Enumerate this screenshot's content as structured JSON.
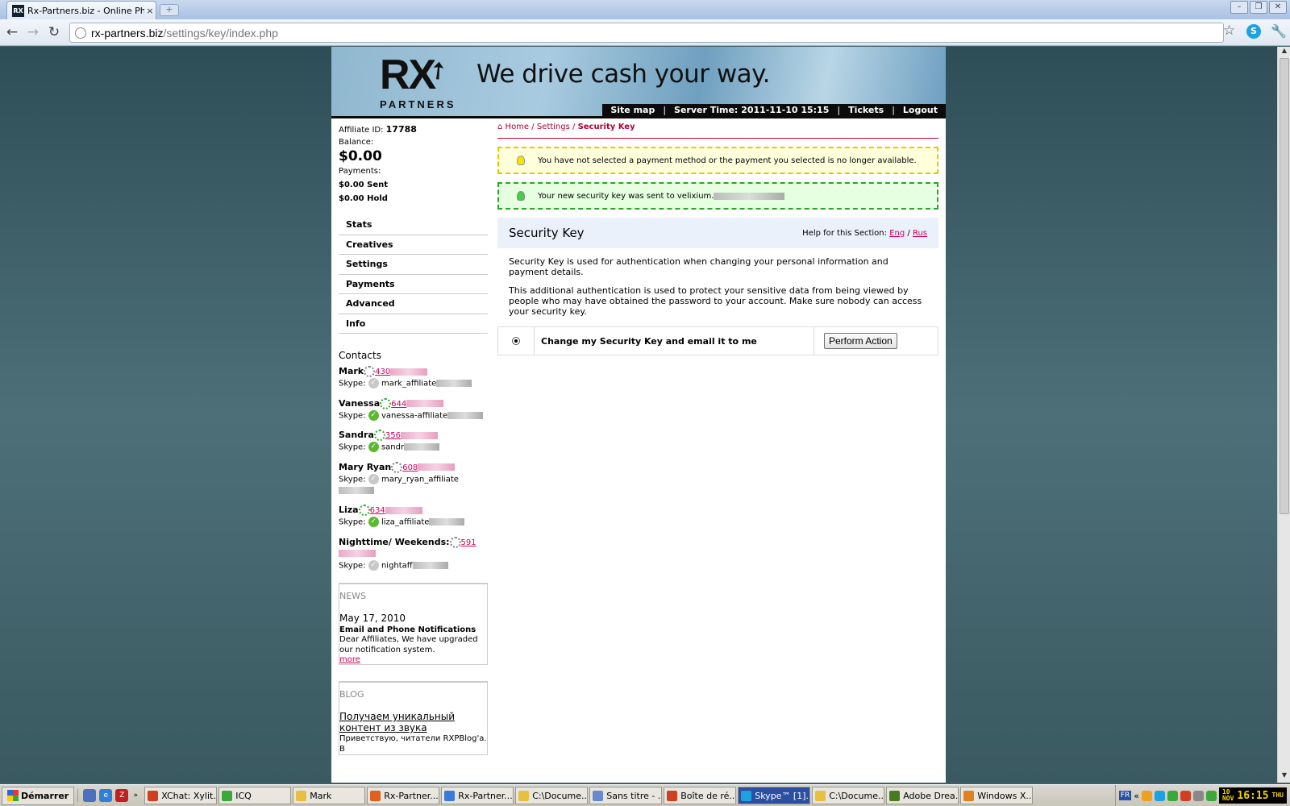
{
  "browser": {
    "tab_title": "Rx-Partners.biz - Online Pharm",
    "tab_close": "×",
    "url_domain": "rx-partners.biz",
    "url_path": "/settings/key/index.php"
  },
  "header": {
    "logo_text": "RX",
    "logo_sub": "PARTNERS",
    "slogan": "We drive cash your way.",
    "nav": {
      "sitemap": "Site map",
      "server_time": "Server Time: 2011-11-10 15:15",
      "tickets": "Tickets",
      "logout": "Logout"
    }
  },
  "sidebar": {
    "affiliate_label": "Affiliate ID:",
    "affiliate_id": "17788",
    "balance_label": "Balance:",
    "balance_value": "$0.00",
    "payments_label": "Payments:",
    "payments_sent": "$0.00 Sent",
    "payments_hold": "$0.00 Hold",
    "menu": [
      "Stats",
      "Creatives",
      "Settings",
      "Payments",
      "Advanced",
      "Info"
    ],
    "contacts_title": "Contacts",
    "skype_label": "Skype:",
    "contacts": [
      {
        "name": "Mark",
        "phone": "430",
        "skype": "mark_affiliate",
        "online": false
      },
      {
        "name": "Vanessa",
        "phone": "644",
        "skype": "vanessa-affiliate",
        "online": true
      },
      {
        "name": "Sandra",
        "phone": "356",
        "skype": "sandr",
        "online": true
      },
      {
        "name": "Mary Ryan",
        "phone": "608",
        "skype": "mary_ryan_affiliate",
        "online": false
      },
      {
        "name": "Liza",
        "phone": "634",
        "skype": "liza_affiliate",
        "online": true
      },
      {
        "name": "Nighttime/ Weekends:",
        "phone": "591",
        "skype": "nightaff",
        "online": false
      }
    ],
    "news": {
      "heading": "NEWS",
      "date": "May 17, 2010",
      "title": "Email and Phone Notifications",
      "text": "Dear Affiliates, We have upgraded our notification system.",
      "more": "more"
    },
    "blog": {
      "heading": "BLOG",
      "title": "Получаем уникальный контент из звука",
      "text": "Приветствую, читатели RXPBlog'а. В"
    }
  },
  "main": {
    "breadcrumb": {
      "home": "Home",
      "sep1": " / ",
      "settings": "Settings",
      "sep2": " / ",
      "current": "Security Key"
    },
    "warning": "You have not selected a payment method or the payment you selected is no longer available.",
    "success": "Your new security key was sent to velixium.",
    "section_title": "Security Key",
    "help_label": "Help for this Section:",
    "help_eng": "Eng",
    "help_sep": " / ",
    "help_rus": "Rus",
    "para1": "Security Key is used for authentication when changing your personal information and payment details.",
    "para2": "This additional authentication is used to protect your sensitive data from being viewed by people who may have obtained the password to your account. Make sure nobody can access your security key.",
    "action_label": "Change my Security Key and email it to me",
    "action_button": "Perform Action"
  },
  "taskbar": {
    "start": "Démarrer",
    "more": "»",
    "tasks": [
      {
        "label": "XChat: Xylit...",
        "color": "#d04020",
        "active": false
      },
      {
        "label": "ICQ",
        "color": "#3aa83a",
        "active": false
      },
      {
        "label": "Mark",
        "color": "#e8c040",
        "active": false
      },
      {
        "label": "Rx-Partner...",
        "color": "#e06020",
        "active": false
      },
      {
        "label": "Rx-Partner...",
        "color": "#3a7ad8",
        "active": false
      },
      {
        "label": "C:\\Docume...",
        "color": "#e8c040",
        "active": false
      },
      {
        "label": "Sans titre - ...",
        "color": "#6a8ad0",
        "active": false
      },
      {
        "label": "Boîte de ré...",
        "color": "#d04020",
        "active": false
      },
      {
        "label": "Skype™ [1]...",
        "color": "#1fa0e0",
        "active": true
      },
      {
        "label": "C:\\Docume...",
        "color": "#e8c040",
        "active": false
      },
      {
        "label": "Adobe Drea...",
        "color": "#4a7a20",
        "active": false
      },
      {
        "label": "Windows X...",
        "color": "#e08020",
        "active": false
      }
    ],
    "lang": "FR",
    "tray_more": "«",
    "clock_day": "10",
    "clock_month": "NOV",
    "clock_time": "16:15",
    "clock_dow": "THU"
  },
  "colors": {
    "accent": "#d0005f",
    "breadcrumb": "#b00030",
    "warning_bg": "#ffffdc",
    "success_bg": "#e6ffe0"
  }
}
